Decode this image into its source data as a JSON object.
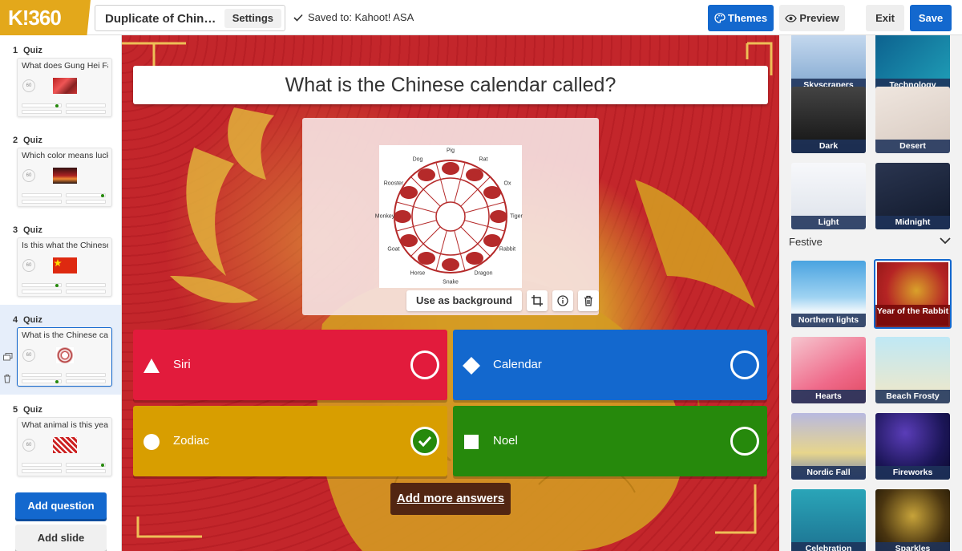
{
  "topbar": {
    "logo": "K!360",
    "title": "Duplicate of Chine...",
    "settings": "Settings",
    "saved": "Saved to: Kahoot! ASA",
    "themes": "Themes",
    "preview": "Preview",
    "exit": "Exit",
    "save": "Save"
  },
  "sidebar": {
    "slides": [
      {
        "num": "1",
        "type": "Quiz",
        "question": "What does Gung Hei Fat Choy mean?",
        "timer": "60"
      },
      {
        "num": "2",
        "type": "Quiz",
        "question": "Which color means luck?",
        "timer": "60"
      },
      {
        "num": "3",
        "type": "Quiz",
        "question": "Is this what the Chinese flag looks like?",
        "timer": "60"
      },
      {
        "num": "4",
        "type": "Quiz",
        "question": "What is the Chinese calendar called?",
        "timer": "60"
      },
      {
        "num": "5",
        "type": "Quiz",
        "question": "What animal is this year?",
        "timer": "60"
      }
    ],
    "add_question": "Add question",
    "add_slide": "Add slide"
  },
  "editor": {
    "question": "What is the Chinese calendar called?",
    "use_as_background": "Use as background",
    "zodiac_labels": [
      "Pig",
      "Rat",
      "Ox",
      "Tiger",
      "Rabbit",
      "Dragon",
      "Snake",
      "Horse",
      "Goat",
      "Monkey",
      "Rooster",
      "Dog"
    ],
    "answers": [
      {
        "text": "Siri",
        "color": "#e21b3c",
        "shape": "triangle",
        "correct": false
      },
      {
        "text": "Calendar",
        "color": "#1368ce",
        "shape": "diamond",
        "correct": false
      },
      {
        "text": "Zodiac",
        "color": "#d89e00",
        "shape": "circle",
        "correct": true
      },
      {
        "text": "Noel",
        "color": "#26890c",
        "shape": "square",
        "correct": false
      }
    ],
    "add_more_answers": "Add more answers"
  },
  "themes": {
    "festive_label": "Festive",
    "items": [
      {
        "label": "Skyscrapers"
      },
      {
        "label": "Technology"
      },
      {
        "label": "Dark"
      },
      {
        "label": "Desert"
      },
      {
        "label": "Light"
      },
      {
        "label": "Midnight"
      },
      {
        "label": "Northern lights"
      },
      {
        "label": "Year of the Rabbit"
      },
      {
        "label": "Hearts"
      },
      {
        "label": "Beach Frosty"
      },
      {
        "label": "Nordic Fall"
      },
      {
        "label": "Fireworks"
      },
      {
        "label": "Celebration"
      },
      {
        "label": "Sparkles"
      }
    ]
  },
  "colors": {
    "accent": "#1368ce",
    "logo": "#e3a81b",
    "red": "#e21b3c",
    "blue": "#1368ce",
    "yellow": "#d89e00",
    "green": "#26890c"
  }
}
